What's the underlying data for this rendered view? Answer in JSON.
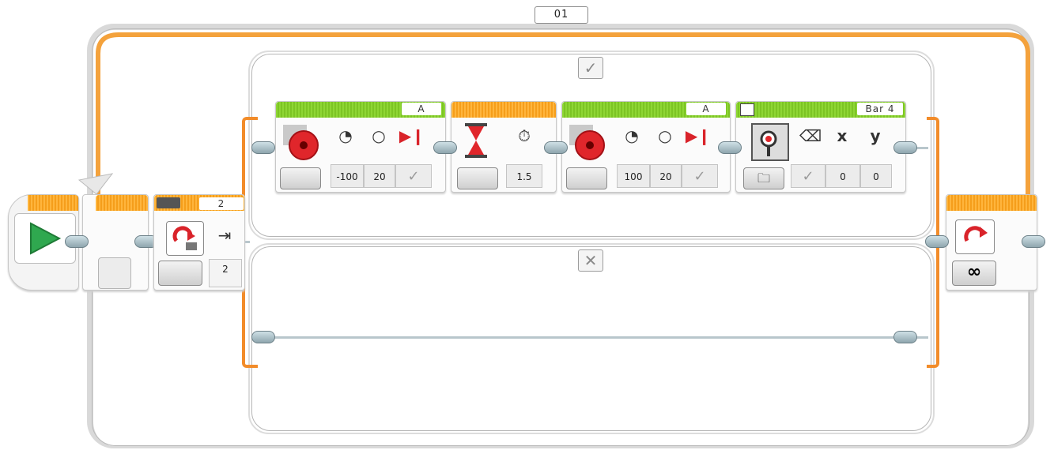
{
  "loop": {
    "name": "01",
    "count_icon": "∞"
  },
  "switch": {
    "count_label": "2",
    "value": "2",
    "true_tag": "✓",
    "false_tag": "✕"
  },
  "blocks": {
    "motor1": {
      "port": "A",
      "power": "-100",
      "value": "20",
      "brake": "✓",
      "mode": "90°"
    },
    "wait": {
      "seconds": "1.5"
    },
    "motor2": {
      "port": "A",
      "power": "100",
      "value": "20",
      "brake": "✓",
      "mode": "90°"
    },
    "display": {
      "label": "Bar 4",
      "clear": "✓",
      "x_label": "x",
      "y_label": "y",
      "x": "0",
      "y": "0"
    }
  },
  "colors": {
    "accent_orange": "#f28c2a",
    "header_green": "#7cc424",
    "start_green": "#2fa84f",
    "motor_red": "#e0262b"
  },
  "icons": [
    "start-icon",
    "loop-icon",
    "motor-icon",
    "timer-icon",
    "display-icon",
    "folder-icon",
    "eraser-icon",
    "infinity-icon"
  ]
}
